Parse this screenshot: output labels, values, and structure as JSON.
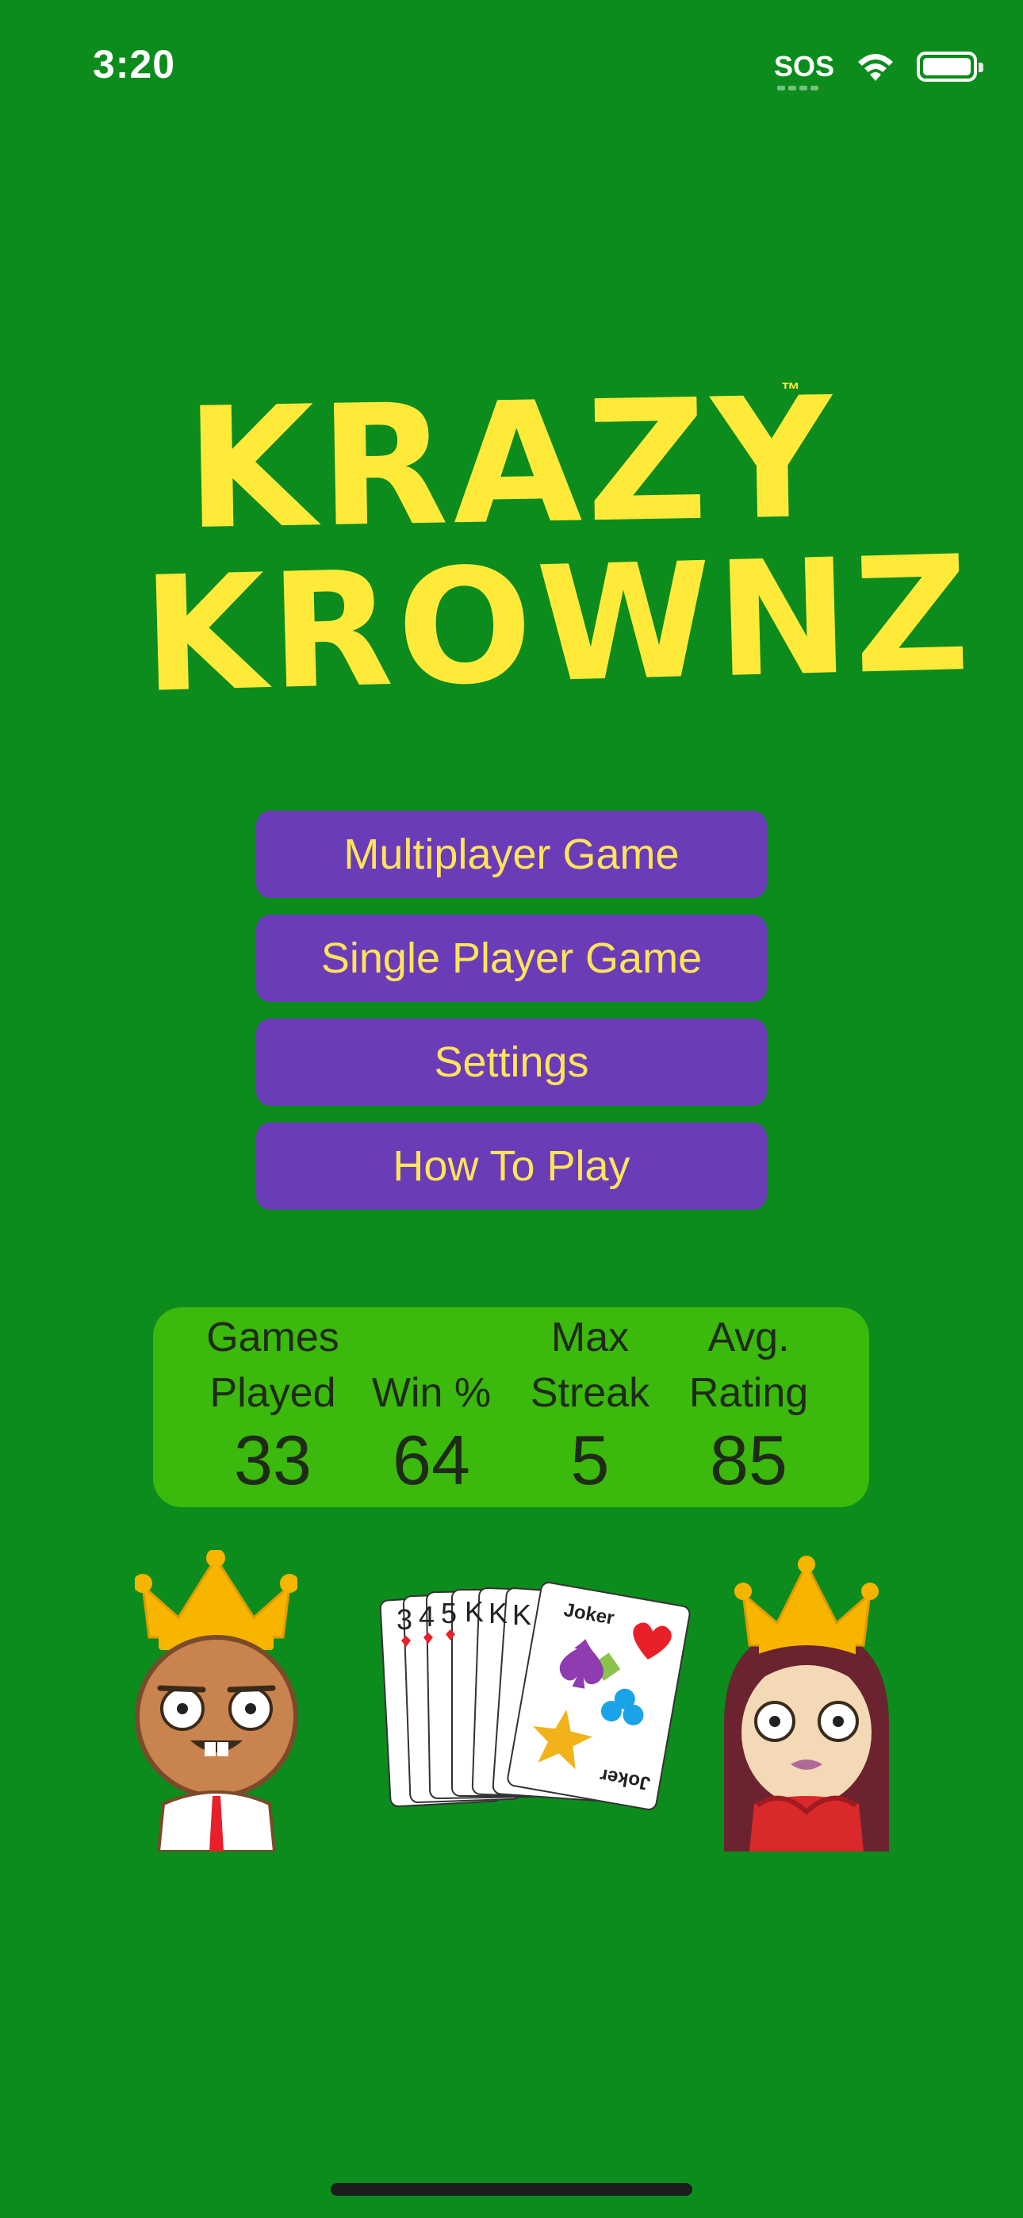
{
  "status_bar": {
    "time": "3:20",
    "sos": "SOS",
    "icons": [
      "wifi-icon",
      "battery-icon"
    ]
  },
  "logo": {
    "line1": "KRAZY",
    "line2": "KROWNZ",
    "tm": "™"
  },
  "menu": {
    "multiplayer": "Multiplayer Game",
    "single_player": "Single Player Game",
    "settings": "Settings",
    "how_to_play": "How To Play"
  },
  "stats": {
    "games_played": {
      "line1": "Games",
      "line2": "Played",
      "value": "33"
    },
    "win_percent": {
      "line1": "",
      "line2": "Win %",
      "value": "64"
    },
    "max_streak": {
      "line1": "Max",
      "line2": "Streak",
      "value": "5"
    },
    "avg_rating": {
      "line1": "Avg.",
      "line2": "Rating",
      "value": "85"
    }
  },
  "cards": {
    "fan_ranks": [
      "3",
      "4",
      "5",
      "K",
      "K",
      "K"
    ],
    "joker_label": "Joker"
  },
  "colors": {
    "background": "#0b8c1c",
    "button": "#6a3cb8",
    "button_text": "#ffe45a",
    "logo": "#ffea3a",
    "stats_panel": "#3cb90d"
  }
}
